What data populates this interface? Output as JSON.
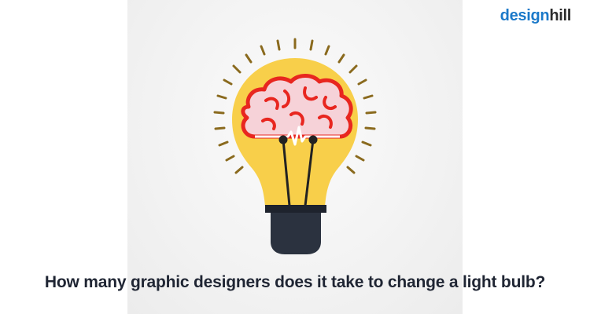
{
  "brand": {
    "logo_part1": "design",
    "logo_part2": "hill",
    "logo_colors": {
      "design": "#1b79c9",
      "hill": "#2c2c2c",
      "leaf": "#7bc043"
    }
  },
  "illustration": {
    "icon": "light-bulb-brain-icon",
    "colors": {
      "bulb_glass": "#f8cf4a",
      "brain_fill": "#f6d2d8",
      "brain_outline": "#e8261f",
      "filament": "#222222",
      "base": "#2b323f",
      "rays": "#8a6a1e"
    }
  },
  "caption": {
    "text": "How many graphic designers does it take to change a light bulb?"
  }
}
